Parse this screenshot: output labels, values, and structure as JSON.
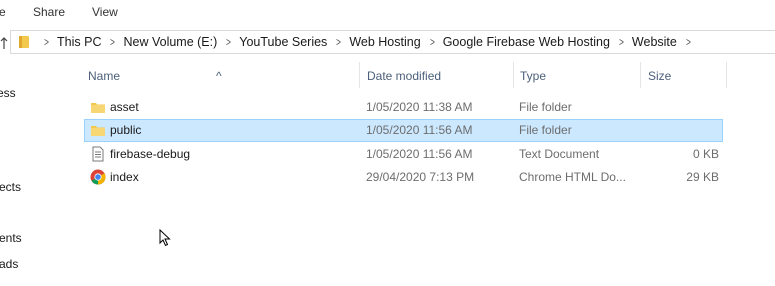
{
  "ribbon": {
    "tabs": [
      "Share",
      "View"
    ],
    "partial_tab": "e"
  },
  "address": {
    "crumbs": [
      "This PC",
      "New Volume (E:)",
      "YouTube Series",
      "Web Hosting",
      "Google Firebase Web Hosting",
      "Website"
    ]
  },
  "nav": {
    "items": [
      "ess",
      "ects",
      "",
      "ents",
      "ads"
    ]
  },
  "columns": {
    "name": "Name",
    "date": "Date modified",
    "type": "Type",
    "size": "Size"
  },
  "files": [
    {
      "name": "asset",
      "date": "1/05/2020 11:38 AM",
      "type": "File folder",
      "size": "",
      "icon": "folder-icon"
    },
    {
      "name": "public",
      "date": "1/05/2020 11:56 AM",
      "type": "File folder",
      "size": "",
      "icon": "folder-icon",
      "selected": true
    },
    {
      "name": "firebase-debug",
      "date": "1/05/2020 11:56 AM",
      "type": "Text Document",
      "size": "0 KB",
      "icon": "text-document-icon"
    },
    {
      "name": "index",
      "date": "29/04/2020 7:13 PM",
      "type": "Chrome HTML Do...",
      "size": "29 KB",
      "icon": "chrome-icon"
    }
  ],
  "colors": {
    "selection_bg": "#cce8ff",
    "selection_border": "#99d1ff",
    "folder": "#f2c94c",
    "header_text": "#4c607a"
  }
}
